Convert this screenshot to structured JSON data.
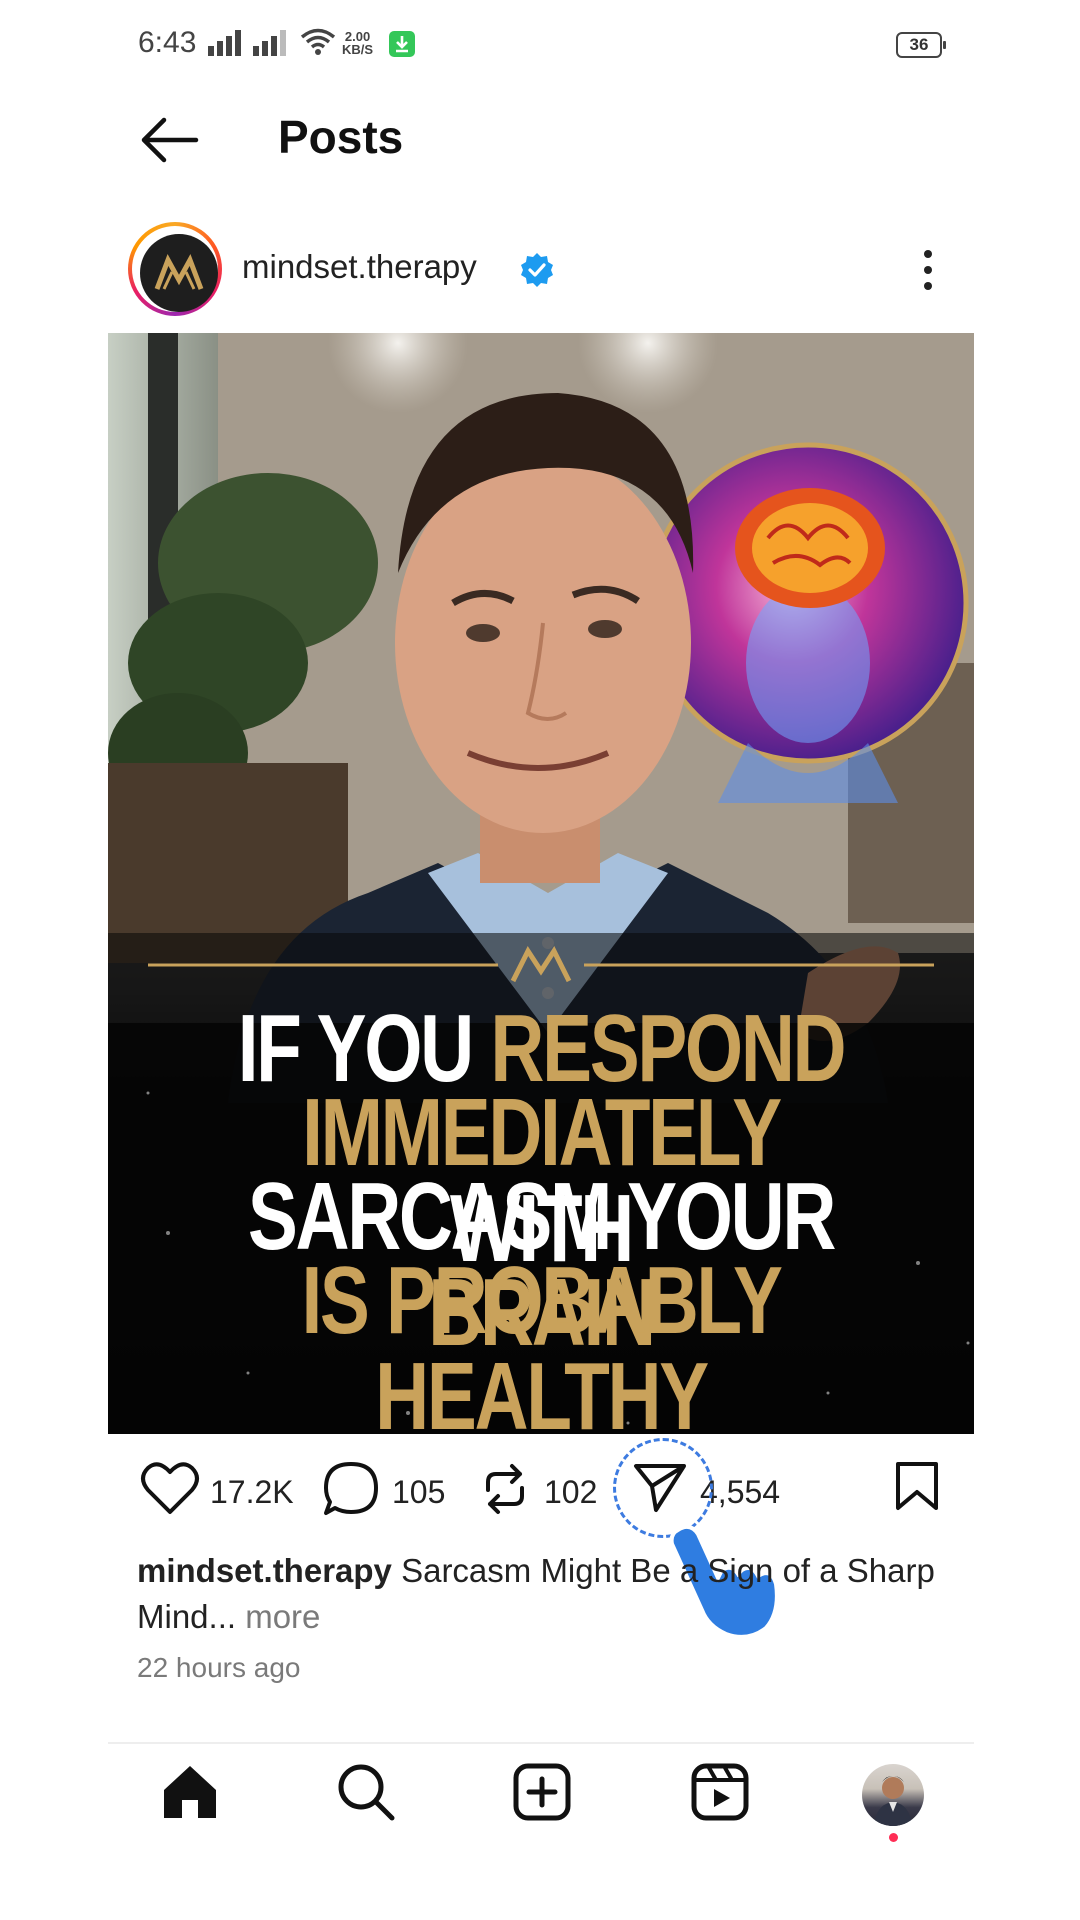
{
  "status_bar": {
    "time": "6:43",
    "network_speed_value": "2.00",
    "network_speed_unit": "KB/S",
    "battery": "36"
  },
  "header": {
    "title": "Posts"
  },
  "post": {
    "username": "mindset.therapy",
    "image_caption_lines": [
      [
        {
          "text": "IF YOU ",
          "color": "white"
        },
        {
          "text": "RESPOND",
          "color": "gold"
        }
      ],
      [
        {
          "text": "IMMEDIATELY ",
          "color": "gold"
        },
        {
          "text": "WITH",
          "color": "white"
        }
      ],
      [
        {
          "text": "SARCASM YOUR ",
          "color": "white"
        },
        {
          "text": "BRAIN",
          "color": "gold"
        }
      ],
      [
        {
          "text": "IS PROBABLY HEALTHY",
          "color": "gold"
        }
      ]
    ],
    "likes": "17.2K",
    "comments": "105",
    "reposts": "102",
    "shares": "4,554",
    "caption_user": "mindset.therapy",
    "caption_text": " Sarcasm Might Be a Sign of a Sharp Mind...",
    "caption_more": " more",
    "time_ago": "22 hours ago"
  },
  "colors": {
    "gold": "#c9a25b",
    "verified": "#1d9bf0",
    "notification_dot": "#ff2d55",
    "tap_indicator": "#3d7be0"
  }
}
